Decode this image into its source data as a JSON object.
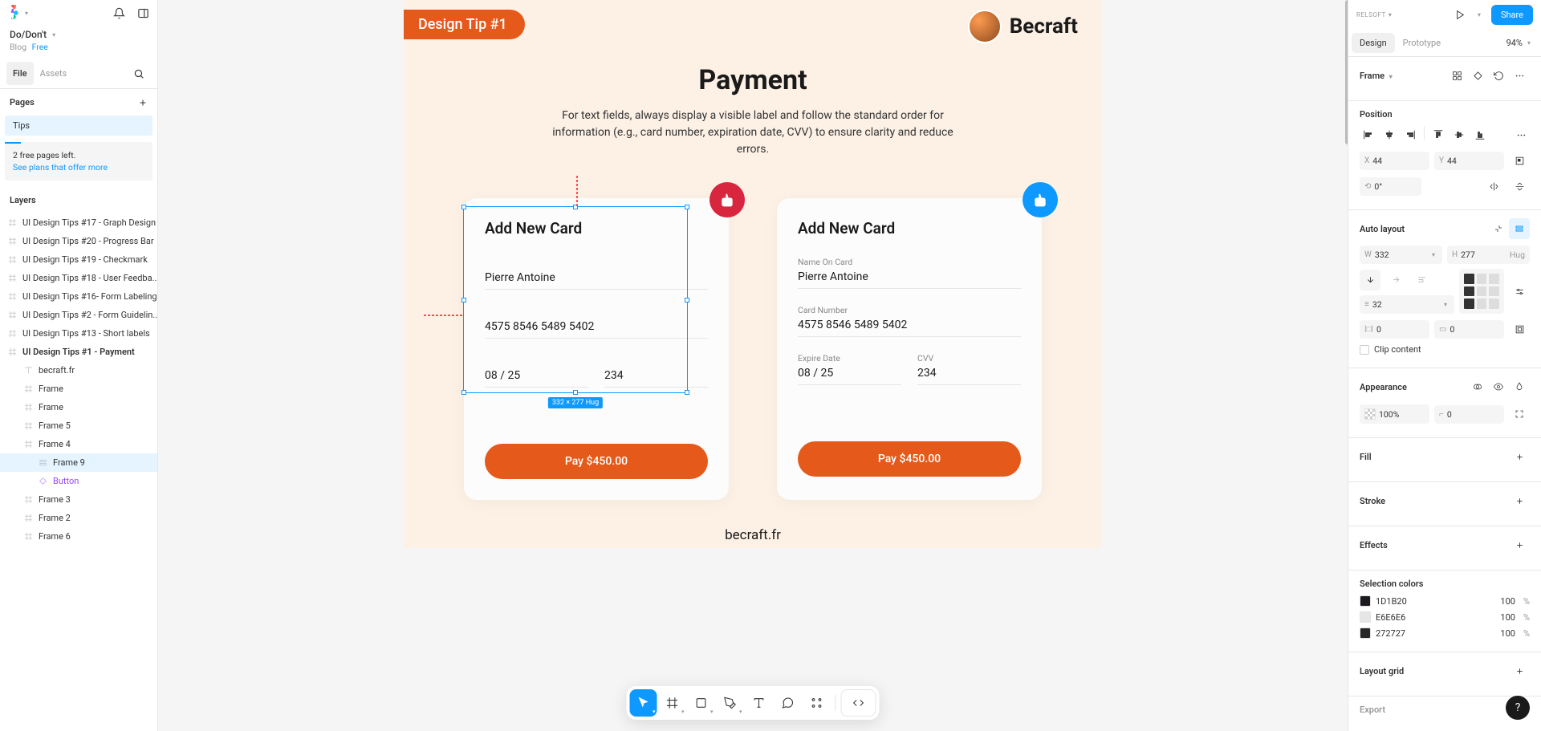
{
  "file": {
    "name": "Do/Don't",
    "team": "Blog",
    "plan": "Free"
  },
  "leftTabs": {
    "file": "File",
    "assets": "Assets"
  },
  "pagesHeader": "Pages",
  "pages": [
    {
      "name": "Tips",
      "active": true
    }
  ],
  "freePages": {
    "line1": "2 free pages left.",
    "link": "See plans that offer more"
  },
  "layersHeader": "Layers",
  "layers": [
    {
      "name": "UI Design Tips #17 - Graph Design",
      "icon": "frame",
      "indent": 0
    },
    {
      "name": "UI Design Tips #20 - Progress Bar",
      "icon": "frame",
      "indent": 0
    },
    {
      "name": "UI Design Tips #19 - Checkmark",
      "icon": "frame",
      "indent": 0
    },
    {
      "name": "UI Design Tips #18 - User Feedba...",
      "icon": "frame",
      "indent": 0
    },
    {
      "name": "UI Design Tips #16- Form Labeling",
      "icon": "frame",
      "indent": 0
    },
    {
      "name": "UI Design Tips #2 - Form Guidelin...",
      "icon": "frame",
      "indent": 0
    },
    {
      "name": "UI Design Tips #13 - Short labels",
      "icon": "frame",
      "indent": 0
    },
    {
      "name": "UI Design Tips #1 - Payment",
      "icon": "frame",
      "indent": 0,
      "bold": true
    },
    {
      "name": "becraft.fr",
      "icon": "text",
      "indent": 1
    },
    {
      "name": "Frame",
      "icon": "frame",
      "indent": 1
    },
    {
      "name": "Frame",
      "icon": "frame",
      "indent": 1
    },
    {
      "name": "Frame 5",
      "icon": "frame",
      "indent": 1
    },
    {
      "name": "Frame 4",
      "icon": "frame",
      "indent": 1
    },
    {
      "name": "Frame 9",
      "icon": "autolayout",
      "indent": 2,
      "selected": true
    },
    {
      "name": "Button",
      "icon": "component",
      "indent": 2,
      "purple": true
    },
    {
      "name": "Frame 3",
      "icon": "frame",
      "indent": 1
    },
    {
      "name": "Frame 2",
      "icon": "frame",
      "indent": 1
    },
    {
      "name": "Frame 6",
      "icon": "frame",
      "indent": 1
    }
  ],
  "artboard": {
    "tipBadge": "Design Tip #1",
    "brand": "Becraft",
    "title": "Payment",
    "desc": "For text fields, always display a visible label and follow the standard order for information (e.g., card number, expiration date, CVV) to ensure clarity and reduce errors.",
    "footerUrl": "becraft.fr",
    "selectionLabel": "332 × 277 Hug",
    "card1": {
      "title": "Add New Card",
      "name": "Pierre Antoine",
      "number": "4575 8546 5489 5402",
      "exp": "08 / 25",
      "cvv": "234",
      "pay": "Pay $450.00"
    },
    "card2": {
      "title": "Add New Card",
      "labelName": "Name On Card",
      "name": "Pierre Antoine",
      "labelNumber": "Card Number",
      "number": "4575 8546 5489 5402",
      "labelExp": "Expire Date",
      "exp": "08 / 25",
      "labelCvv": "CVV",
      "cvv": "234",
      "pay": "Pay $450.00"
    }
  },
  "rp": {
    "dropdown": "RELSOFT",
    "share": "Share",
    "tabs": {
      "design": "Design",
      "prototype": "Prototype"
    },
    "zoom": "94%",
    "frameLabel": "Frame",
    "position": {
      "title": "Position",
      "x": "44",
      "y": "44",
      "rotation": "0°"
    },
    "autolayout": {
      "title": "Auto layout",
      "w": "332",
      "h": "277",
      "hug": "Hug",
      "gap": "32",
      "padH": "0",
      "padV": "0",
      "clip": "Clip content"
    },
    "appearance": {
      "title": "Appearance",
      "opacity": "100%",
      "radius": "0"
    },
    "fill": "Fill",
    "stroke": "Stroke",
    "effects": "Effects",
    "selColors": {
      "title": "Selection colors",
      "rows": [
        {
          "hex": "1D1B20",
          "val": "100",
          "unit": "%"
        },
        {
          "hex": "E6E6E6",
          "val": "100",
          "unit": "%"
        },
        {
          "hex": "272727",
          "val": "100",
          "unit": "%"
        }
      ]
    },
    "layoutGrid": "Layout grid",
    "export": "Export"
  }
}
